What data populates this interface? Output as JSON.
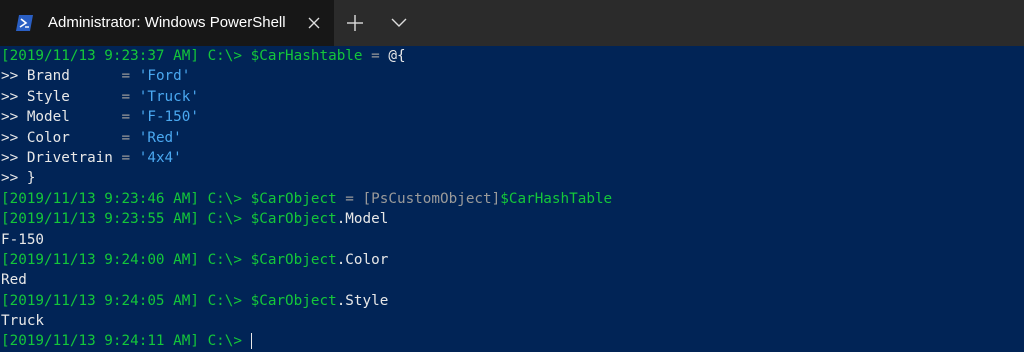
{
  "window": {
    "tab_title": "Administrator: Windows PowerShell",
    "tab_icon": "powershell-icon",
    "close_icon": "close-icon",
    "new_tab_icon": "plus-icon",
    "dropdown_icon": "chevron-down-icon"
  },
  "console": {
    "line1": {
      "prompt": "[2019/11/13 9:23:37 AM] C:\\> ",
      "var": "$CarHashtable",
      "op": " = ",
      "rest": "@{"
    },
    "line2": {
      "cont": ">> ",
      "key": "Brand      ",
      "op": "= ",
      "str": "'Ford'"
    },
    "line3": {
      "cont": ">> ",
      "key": "Style      ",
      "op": "= ",
      "str": "'Truck'"
    },
    "line4": {
      "cont": ">> ",
      "key": "Model      ",
      "op": "= ",
      "str": "'F-150'"
    },
    "line5": {
      "cont": ">> ",
      "key": "Color      ",
      "op": "= ",
      "str": "'Red'"
    },
    "line6": {
      "cont": ">> ",
      "key": "Drivetrain ",
      "op": "= ",
      "str": "'4x4'"
    },
    "line7": {
      "text": ">> }"
    },
    "line8": {
      "prompt": "[2019/11/13 9:23:46 AM] C:\\> ",
      "var": "$CarObject",
      "op": " = ",
      "type": "[PsCustomObject]",
      "var2": "$CarHashTable"
    },
    "line9": {
      "prompt": "[2019/11/13 9:23:55 AM] C:\\> ",
      "var": "$CarObject",
      "member": ".Model"
    },
    "line10": {
      "text": "F-150"
    },
    "line11": {
      "prompt": "[2019/11/13 9:24:00 AM] C:\\> ",
      "var": "$CarObject",
      "member": ".Color"
    },
    "line12": {
      "text": "Red"
    },
    "line13": {
      "prompt": "[2019/11/13 9:24:05 AM] C:\\> ",
      "var": "$CarObject",
      "member": ".Style"
    },
    "line14": {
      "text": "Truck"
    },
    "line15": {
      "prompt": "[2019/11/13 9:24:11 AM] C:\\> "
    }
  }
}
